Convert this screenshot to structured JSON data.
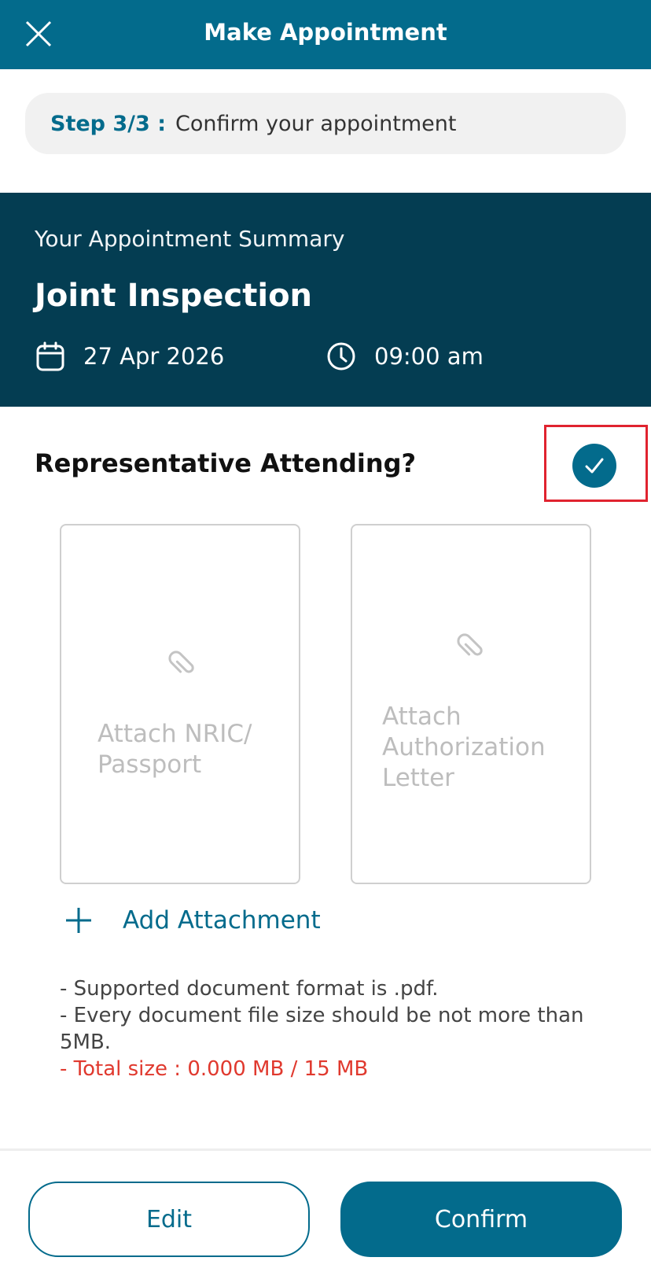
{
  "header": {
    "title": "Make Appointment",
    "close_icon": "close-icon"
  },
  "step": {
    "label": "Step 3/3 :",
    "text": "Confirm your appointment"
  },
  "summary": {
    "subtitle": "Your Appointment Summary",
    "title": "Joint Inspection",
    "date": "27 Apr 2026",
    "time": "09:00 am",
    "date_icon": "calendar-icon",
    "time_icon": "clock-icon"
  },
  "representative": {
    "label": "Representative Attending?",
    "checked": true
  },
  "attachments": {
    "cards": [
      {
        "label": "Attach NRIC/\nPassport",
        "icon": "paperclip-icon"
      },
      {
        "label": "Attach\nAuthorization\nLetter",
        "icon": "paperclip-icon"
      }
    ],
    "add_label": "Add Attachment"
  },
  "notes": {
    "line1": "- Supported document format is .pdf.",
    "line2": "- Every document file size should be not more than 5MB.",
    "total": "- Total size :  0.000 MB / 15 MB"
  },
  "actions": {
    "edit_label": "Edit",
    "confirm_label": "Confirm"
  },
  "colors": {
    "primary": "#036b8c",
    "summary_bg": "#043d52",
    "highlight": "#e0232f",
    "error_text": "#e0392e"
  }
}
